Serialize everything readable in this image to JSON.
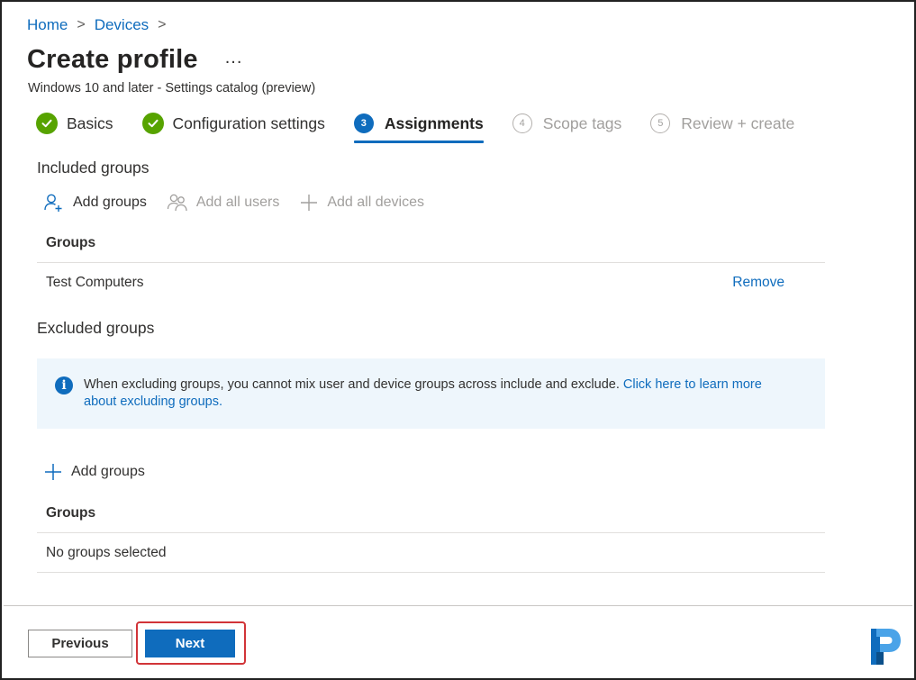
{
  "breadcrumb": {
    "home": "Home",
    "devices": "Devices",
    "separator": ">"
  },
  "header": {
    "title": "Create profile",
    "more": "...",
    "subtitle": "Windows 10 and later - Settings catalog (preview)"
  },
  "wizard": {
    "steps": [
      {
        "label": "Basics",
        "state": "completed"
      },
      {
        "label": "Configuration settings",
        "state": "completed"
      },
      {
        "number": "3",
        "label": "Assignments",
        "state": "current"
      },
      {
        "number": "4",
        "label": "Scope tags",
        "state": "inactive"
      },
      {
        "number": "5",
        "label": "Review + create",
        "state": "inactive"
      }
    ]
  },
  "included": {
    "heading": "Included groups",
    "commands": {
      "add_groups": "Add groups",
      "add_all_users": "Add all users",
      "add_all_devices": "Add all devices"
    },
    "table": {
      "header": "Groups",
      "rows": [
        {
          "name": "Test Computers",
          "action": "Remove"
        }
      ]
    }
  },
  "excluded": {
    "heading": "Excluded groups",
    "info": {
      "text": "When excluding groups, you cannot mix user and device groups across include and exclude.",
      "link": "Click here to learn more about excluding groups."
    },
    "commands": {
      "add_groups": "Add groups"
    },
    "table": {
      "header": "Groups",
      "empty": "No groups selected"
    }
  },
  "footer": {
    "previous": "Previous",
    "next": "Next"
  },
  "colors": {
    "accent": "#0f6cbd",
    "success": "#57a300",
    "highlight": "#d13438",
    "info_bg": "#eef6fc"
  },
  "icons": {
    "completed": "checkmark-icon",
    "info": "info-icon",
    "add_groups": "person-add-icon",
    "add_users": "people-icon",
    "add_devices": "plus-icon"
  }
}
